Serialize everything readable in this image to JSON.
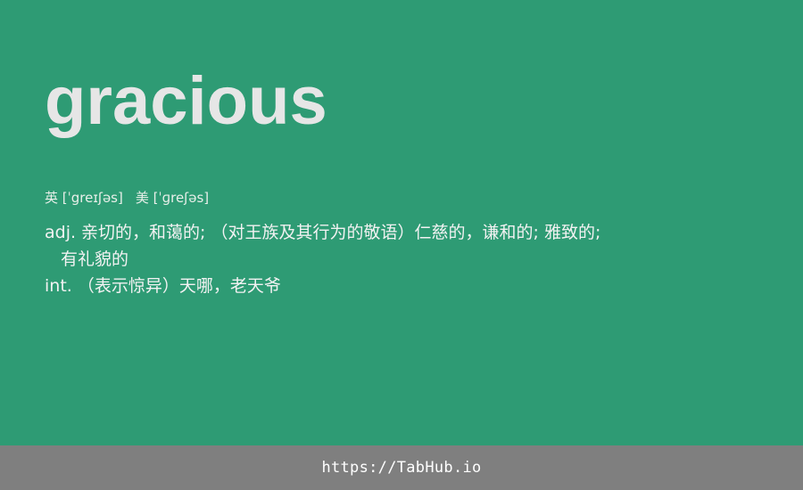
{
  "word": "gracious",
  "phonetics": {
    "uk": "英 [ˈgreɪʃəs]",
    "us": "美 [ˈɡreʃəs]"
  },
  "definitions": {
    "line1": "adj. 亲切的，和蔼的; （对王族及其行为的敬语）仁慈的，谦和的; 雅致的;",
    "line2": "有礼貌的",
    "line3": "int. （表示惊异）天哪，老天爷"
  },
  "footer": {
    "link": "https://TabHub.io"
  },
  "colors": {
    "background": "#2e9b74",
    "footer_background": "#7f7f7f",
    "word_color": "#e6e6e6"
  }
}
